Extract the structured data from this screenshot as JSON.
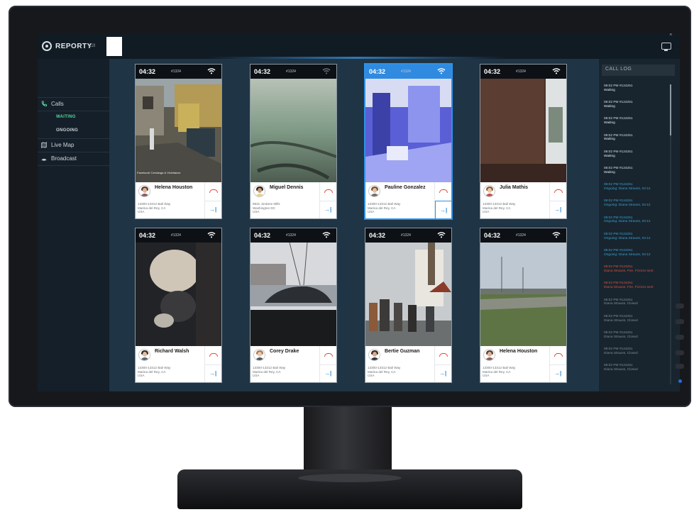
{
  "app": {
    "logo_text": "REPORTY",
    "logo_sub": "C2I",
    "close": "×"
  },
  "sidebar": {
    "calls": "Calls",
    "waiting": "WAITING",
    "ongoing": "ONGOING",
    "live_map": "Live Map",
    "broadcast": "Broadcast"
  },
  "cards": [
    {
      "time": "04:32",
      "id": "#1324",
      "name": "Helena Houston",
      "addr": "13300-13312 Bali Way\nMarina del Rey, CA\nUSA",
      "caption": "Facebook/ Cerdanga & Vicinitance",
      "active": false
    },
    {
      "time": "04:32",
      "id": "#1324",
      "name": "Miguel Dennis",
      "addr": "8931 Jordane Mills\nWashington DC\nUSA",
      "caption": "",
      "active": false
    },
    {
      "time": "04:32",
      "id": "#1324",
      "name": "Pauline Gonzalez",
      "addr": "13300-13312 Bali Way\nMarina del Rey, CA\nUSA",
      "caption": "",
      "active": true
    },
    {
      "time": "04:32",
      "id": "#1324",
      "name": "Julia Mathis",
      "addr": "13300-13312 Bali Way\nMarina del Rey, CA\nUSA",
      "caption": "",
      "active": false
    },
    {
      "time": "04:32",
      "id": "#1324",
      "name": "Richard Walsh",
      "addr": "13300-13312 Bali Way\nMarina del Rey, CA\nUSA",
      "caption": "",
      "active": false
    },
    {
      "time": "04:32",
      "id": "#1324",
      "name": "Corey Drake",
      "addr": "13300-13312 Bali Way\nMarina del Rey, CA\nUSA",
      "caption": "",
      "active": false
    },
    {
      "time": "04:32",
      "id": "#1324",
      "name": "Bertie Guzman",
      "addr": "13300-13312 Bali Way\nMarina del Rey, CA\nUSA",
      "caption": "",
      "active": false
    },
    {
      "time": "04:32",
      "id": "#1324",
      "name": "Helena Houston",
      "addr": "13300-13312 Bali Way\nMarina del Rey, CA\nUSA",
      "caption": "",
      "active": false
    }
  ],
  "call_log": {
    "title": "CALL LOG",
    "entries": [
      {
        "line1": "08:02 PM #124251",
        "line2": "Waiting",
        "status": "waiting"
      },
      {
        "line1": "08:02 PM #124251",
        "line2": "Waiting",
        "status": "waiting"
      },
      {
        "line1": "08:02 PM #124251",
        "line2": "Waiting",
        "status": "waiting"
      },
      {
        "line1": "08:02 PM #124251",
        "line2": "Waiting",
        "status": "waiting"
      },
      {
        "line1": "08:02 PM #124251",
        "line2": "Waiting",
        "status": "waiting"
      },
      {
        "line1": "08:02 PM #124251",
        "line2": "Waiting",
        "status": "waiting"
      },
      {
        "line1": "08:02 PM #124251",
        "line2": "Ongoing: Diana Strauss, 04:12",
        "status": "ongoing"
      },
      {
        "line1": "08:02 PM #124251",
        "line2": "Ongoing: Diana Strauss, 04:12",
        "status": "ongoing"
      },
      {
        "line1": "08:02 PM #124251",
        "line2": "Ongoing: Diana Strauss, 04:12",
        "status": "ongoing"
      },
      {
        "line1": "08:02 PM #124251",
        "line2": "Ongoing: Diana Strauss, 04:12",
        "status": "ongoing"
      },
      {
        "line1": "08:02 PM #124251",
        "line2": "Ongoing: Diana Strauss, 04:12",
        "status": "ongoing"
      },
      {
        "line1": "08:02 PM #124251",
        "line2": "Diana Strauss, Fire, Firzzzo sent",
        "status": "alert"
      },
      {
        "line1": "08:02 PM #124251",
        "line2": "Diana Strauss, Fire, Firzzzo sent",
        "status": "alert"
      },
      {
        "line1": "08:02 PM #124251",
        "line2": "Diana Strauss, Closed",
        "status": "closed"
      },
      {
        "line1": "08:02 PM #124251",
        "line2": "Diana Strauss, Closed",
        "status": "closed"
      },
      {
        "line1": "08:02 PM #124251",
        "line2": "Diana Strauss, Closed",
        "status": "closed"
      },
      {
        "line1": "08:02 PM #124251",
        "line2": "Diana Strauss, Closed",
        "status": "closed"
      },
      {
        "line1": "08:02 PM #124251",
        "line2": "Diana Strauss, Closed",
        "status": "closed"
      }
    ]
  },
  "colors": {
    "accent": "#2f8ae0",
    "waiting": "#e8ecef",
    "ongoing": "#3aa0d0",
    "alert": "#d9503a",
    "closed": "#7f8b95",
    "sidebar_active": "#58d6a0"
  }
}
